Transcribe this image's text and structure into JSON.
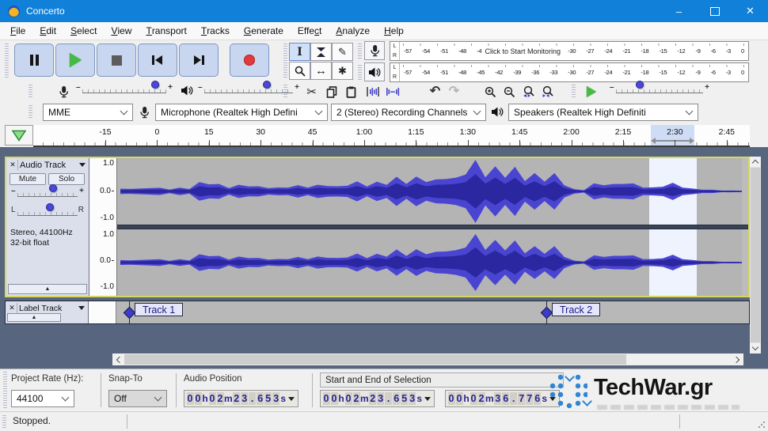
{
  "titlebar": {
    "title": "Concerto"
  },
  "icons": {
    "minimize": "–",
    "close": "✕",
    "selection_tool": "I",
    "draw_tool": "✎",
    "time_shift_tool": "↔",
    "multi_tool": "✱",
    "cut": "✂",
    "undo": "↶",
    "redo": "↷",
    "collapse": "▲"
  },
  "menubar": {
    "items": [
      {
        "label": "File",
        "accel": 0
      },
      {
        "label": "Edit",
        "accel": 0
      },
      {
        "label": "Select",
        "accel": 0
      },
      {
        "label": "View",
        "accel": 0
      },
      {
        "label": "Transport",
        "accel": 0
      },
      {
        "label": "Tracks",
        "accel": 0
      },
      {
        "label": "Generate",
        "accel": 0
      },
      {
        "label": "Effect",
        "accel": 4
      },
      {
        "label": "Analyze",
        "accel": 0
      },
      {
        "label": "Help",
        "accel": 0
      }
    ]
  },
  "meters": {
    "scale": [
      "-57",
      "-54",
      "-51",
      "-48",
      "-45",
      "-42",
      "-39",
      "-36",
      "-33",
      "-30",
      "-27",
      "-24",
      "-21",
      "-18",
      "-15",
      "-12",
      "-9",
      "-6",
      "-3",
      "0"
    ],
    "channels": [
      "L",
      "R"
    ],
    "monitor_overlay": "Click to Start Monitoring"
  },
  "device": {
    "host": "MME",
    "input": "Microphone (Realtek High Defini",
    "channels": "2 (Stereo) Recording Channels",
    "output": "Speakers (Realtek High Definiti"
  },
  "ruler": {
    "labels": [
      "-15",
      "0",
      "15",
      "30",
      "45",
      "1:00",
      "1:15",
      "1:30",
      "1:45",
      "2:00",
      "2:15",
      "2:30",
      "2:45"
    ]
  },
  "audio_track": {
    "title": "Audio Track",
    "mute": "Mute",
    "solo": "Solo",
    "gain_min": "–",
    "gain_max": "+",
    "pan_left": "L",
    "pan_right": "R",
    "info1": "Stereo, 44100Hz",
    "info2": "32-bit float",
    "scale": [
      "1.0",
      "0.0",
      "-1.0"
    ]
  },
  "label_track": {
    "title": "Label Track",
    "labels": [
      {
        "text": "Track 1",
        "pos": 16
      },
      {
        "text": "Track 2",
        "pos": 543
      }
    ]
  },
  "selection_bar": {
    "rate_label": "Project Rate (Hz):",
    "rate": "44100",
    "snap_label": "Snap-To",
    "snap": "Off",
    "position_label": "Audio Position",
    "selection_label": "Start and End of Selection",
    "audio_position": "00h02m23.653s",
    "sel_start": "00h02m23.653s",
    "sel_end": "00h02m36.776s"
  },
  "status": {
    "text": "Stopped."
  },
  "watermark": {
    "text": "TechWar.gr"
  },
  "waveform_envelope": [
    0.08,
    0.12,
    0.1,
    0.14,
    0.11,
    0.09,
    0.13,
    0.1,
    0.28,
    0.34,
    0.26,
    0.14,
    0.2,
    0.24,
    0.18,
    0.14,
    0.12,
    0.18,
    0.22,
    0.16,
    0.2,
    0.26,
    0.18,
    0.24,
    0.3,
    0.24,
    0.34,
    0.28,
    0.44,
    0.36,
    0.52,
    0.4,
    0.36,
    0.6,
    0.48,
    0.72,
    0.95,
    0.68,
    0.88,
    0.58,
    0.74,
    0.5,
    0.64,
    0.42,
    0.55,
    0.3,
    0.08,
    0.05,
    0.24,
    0.3,
    0.26,
    0.32,
    0.24,
    0.18,
    0.14,
    0.2,
    0.26,
    0.18,
    0.1,
    0.07,
    0.05,
    0.04,
    0.03,
    0.02
  ],
  "colors": {
    "titlebar": "#1180d8",
    "waveform": "#4a45d1",
    "waveform_core": "#2b27a0",
    "track_bg": "#b4b4b4",
    "selection_highlight": "#eef3fd",
    "workspace_bg": "#57657f",
    "focus_border": "#d8d85c",
    "record_red": "#e03a3a",
    "play_green": "#46b946"
  }
}
